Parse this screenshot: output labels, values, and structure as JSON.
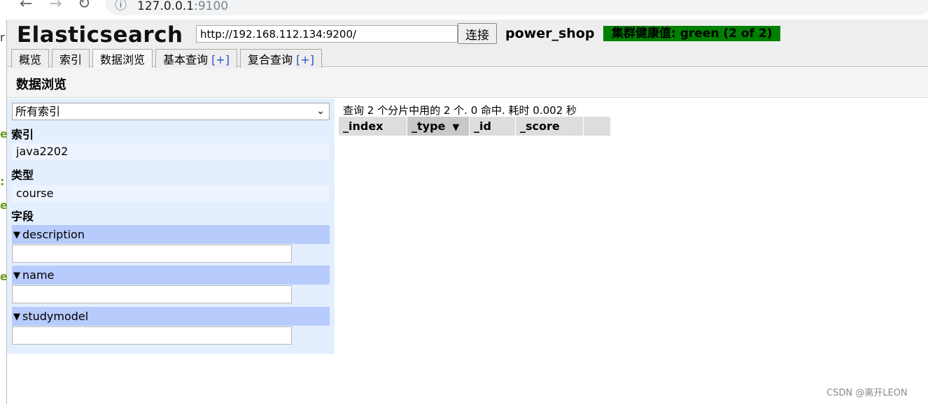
{
  "browser": {
    "back_icon": "←",
    "forward_icon": "→",
    "reload_icon": "↻",
    "info_icon": "ⓘ",
    "url_host": "127.0.0.1",
    "url_port": ":9100"
  },
  "stray_chars": [
    "r",
    "e",
    ":",
    "e",
    "e"
  ],
  "header": {
    "brand": "Elasticsearch",
    "connect_url": "http://192.168.112.134:9200/",
    "connect_label": "连接",
    "cluster_name": "power_shop",
    "health_text": "集群健康值: green (2 of 2)",
    "health_color": "#008000"
  },
  "tabs": [
    {
      "label": "概览",
      "plus": ""
    },
    {
      "label": "索引",
      "plus": ""
    },
    {
      "label": "数据浏览",
      "plus": ""
    },
    {
      "label": "基本查询",
      "plus": "[+]"
    },
    {
      "label": "复合查询",
      "plus": "[+]"
    }
  ],
  "section_title": "数据浏览",
  "filters": {
    "index_select_value": "所有索引",
    "index_label": "索引",
    "index_items": [
      "java2202"
    ],
    "type_label": "类型",
    "type_items": [
      "course"
    ],
    "field_label": "字段",
    "fields": [
      "description",
      "name",
      "studymodel"
    ]
  },
  "results": {
    "summary": "查询 2 个分片中用的 2 个. 0 命中. 耗时 0.002 秒",
    "columns": [
      {
        "label": "_index",
        "sorted": false
      },
      {
        "label": "_type",
        "sorted": true,
        "arrow": "▼"
      },
      {
        "label": "_id",
        "sorted": false
      },
      {
        "label": "_score",
        "sorted": false
      },
      {
        "label": "",
        "sorted": false
      }
    ]
  },
  "watermark": "CSDN @离开LEON"
}
